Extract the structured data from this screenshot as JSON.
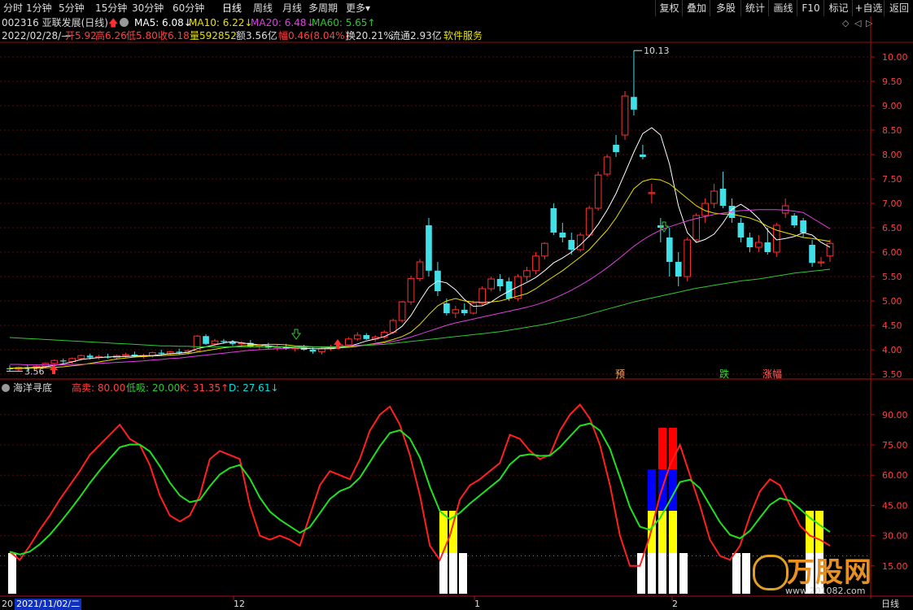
{
  "toolbar": {
    "periods": [
      "分时",
      "1分钟",
      "5分钟",
      "15分钟",
      "30分钟",
      "60分钟",
      "日线",
      "周线",
      "月线",
      "多周期",
      "更多"
    ],
    "active_period": "日线",
    "more_arrow": "▾",
    "right_buttons": [
      "复权",
      "叠加",
      "多股",
      "统计",
      "画线",
      "F10",
      "标记",
      "+自选",
      "返回"
    ]
  },
  "stock": {
    "code_name": "002316 亚联发展(日线)",
    "ma_labels": [
      {
        "text": "MA5: 6.08↓",
        "color": "#ffffff"
      },
      {
        "text": "MA10: 6.22↓",
        "color": "#e8e000"
      },
      {
        "text": "MA20: 6.48↓",
        "color": "#e040e0"
      },
      {
        "text": "MA60: 5.65↑",
        "color": "#30c830"
      }
    ],
    "date": "2022/02/28/—",
    "open": "开5.92",
    "high": "高6.26",
    "low": "低5.80",
    "close": "收6.18",
    "volume": "量592852",
    "amount": "额3.56亿",
    "change": "幅0.46(8.04%)",
    "turnover": "换20.21%",
    "float_cap": "流通2.93亿",
    "sector": "软件服务"
  },
  "price_panel": {
    "y_ticks": [
      "10.00",
      "9.50",
      "9.00",
      "8.50",
      "8.00",
      "7.50",
      "7.00",
      "6.50",
      "6.00",
      "5.50",
      "5.00",
      "4.50",
      "4.00",
      "3.50"
    ],
    "max_label": "10.13",
    "min_label": "3.56",
    "signal_labels": [
      {
        "text": "预",
        "color": "#ffb060"
      },
      {
        "text": "跌",
        "color": "#30e030"
      },
      {
        "text": "涨幅",
        "color": "#ff6060"
      }
    ]
  },
  "indicator": {
    "name": "海洋寻底",
    "params": [
      {
        "text": "高卖: 80.00",
        "color": "#ff4040"
      },
      {
        "text": "低吸: 20.00",
        "color": "#30c830"
      },
      {
        "text": "K: 31.35↑",
        "color": "#ff4040"
      },
      {
        "text": "D: 27.61↓",
        "color": "#00e0e0"
      }
    ],
    "y_ticks": [
      "90.00",
      "75.00",
      "60.00",
      "45.00",
      "30.00",
      "15.00"
    ]
  },
  "date_axis": {
    "cursor_date": "2021/11/02/二",
    "left_stub": "20",
    "months": [
      "12",
      "1",
      "2"
    ],
    "period_label": "日线"
  },
  "watermark": {
    "text": "万股网",
    "sub": "www.201082.com"
  },
  "colors": {
    "up": "#ff3030",
    "down": "#40e0e8",
    "k": "#ff2020",
    "d": "#20e020",
    "ma5": "#ffffff",
    "ma10": "#e8e000",
    "ma20": "#e040e0",
    "ma60": "#30c830"
  },
  "chart_data": {
    "type": "candlestick",
    "price_range": [
      3.4,
      10.3
    ],
    "candles": [
      [
        3.62,
        3.68,
        3.55,
        3.6
      ],
      [
        3.6,
        3.66,
        3.56,
        3.64
      ],
      [
        3.64,
        3.7,
        3.58,
        3.62
      ],
      [
        3.62,
        3.68,
        3.58,
        3.66
      ],
      [
        3.66,
        3.74,
        3.62,
        3.72
      ],
      [
        3.72,
        3.8,
        3.68,
        3.78
      ],
      [
        3.78,
        3.82,
        3.72,
        3.76
      ],
      [
        3.76,
        3.84,
        3.72,
        3.82
      ],
      [
        3.82,
        3.9,
        3.78,
        3.88
      ],
      [
        3.88,
        3.92,
        3.8,
        3.84
      ],
      [
        3.84,
        3.9,
        3.8,
        3.86
      ],
      [
        3.86,
        3.92,
        3.82,
        3.84
      ],
      [
        3.84,
        3.9,
        3.8,
        3.88
      ],
      [
        3.88,
        3.94,
        3.84,
        3.9
      ],
      [
        3.9,
        3.96,
        3.84,
        3.86
      ],
      [
        3.86,
        3.92,
        3.82,
        3.88
      ],
      [
        3.88,
        3.96,
        3.84,
        3.94
      ],
      [
        3.94,
        4.0,
        3.88,
        3.92
      ],
      [
        3.92,
        3.98,
        3.88,
        3.96
      ],
      [
        3.96,
        4.02,
        3.9,
        3.94
      ],
      [
        3.94,
        4.0,
        3.9,
        3.98
      ],
      [
        3.98,
        4.3,
        3.96,
        4.28
      ],
      [
        4.28,
        4.32,
        4.1,
        4.12
      ],
      [
        4.12,
        4.22,
        4.08,
        4.18
      ],
      [
        4.18,
        4.22,
        4.12,
        4.16
      ],
      [
        4.16,
        4.2,
        4.08,
        4.12
      ],
      [
        4.12,
        4.18,
        4.06,
        4.14
      ],
      [
        4.14,
        4.2,
        4.04,
        4.06
      ],
      [
        4.06,
        4.12,
        4.0,
        4.08
      ],
      [
        4.08,
        4.14,
        4.02,
        4.04
      ],
      [
        4.04,
        4.1,
        3.98,
        4.06
      ],
      [
        4.06,
        4.12,
        4.0,
        4.02
      ],
      [
        4.02,
        4.08,
        3.96,
        4.04
      ],
      [
        4.04,
        4.1,
        3.98,
        4.0
      ],
      [
        4.0,
        4.06,
        3.92,
        3.96
      ],
      [
        3.96,
        4.04,
        3.9,
        4.02
      ],
      [
        4.02,
        4.1,
        3.98,
        4.06
      ],
      [
        4.06,
        4.14,
        4.02,
        4.1
      ],
      [
        4.1,
        4.26,
        4.06,
        4.22
      ],
      [
        4.22,
        4.36,
        4.18,
        4.3
      ],
      [
        4.3,
        4.34,
        4.2,
        4.22
      ],
      [
        4.22,
        4.3,
        4.16,
        4.26
      ],
      [
        4.26,
        4.4,
        4.22,
        4.36
      ],
      [
        4.36,
        4.64,
        4.32,
        4.6
      ],
      [
        4.6,
        5.0,
        4.56,
        4.98
      ],
      [
        4.98,
        5.52,
        4.92,
        5.46
      ],
      [
        5.46,
        5.86,
        5.4,
        5.8
      ],
      [
        6.55,
        6.7,
        5.5,
        5.62
      ],
      [
        5.62,
        5.8,
        5.1,
        5.2
      ],
      [
        4.95,
        5.05,
        4.7,
        4.75
      ],
      [
        4.75,
        4.9,
        4.65,
        4.82
      ],
      [
        4.82,
        4.95,
        4.7,
        4.75
      ],
      [
        4.75,
        5.0,
        4.72,
        4.95
      ],
      [
        4.95,
        5.3,
        4.9,
        5.25
      ],
      [
        5.25,
        5.5,
        5.2,
        5.45
      ],
      [
        5.45,
        5.55,
        5.2,
        5.3
      ],
      [
        5.4,
        5.48,
        5.0,
        5.05
      ],
      [
        5.05,
        5.55,
        5.0,
        5.5
      ],
      [
        5.5,
        5.7,
        5.4,
        5.62
      ],
      [
        5.62,
        6.0,
        5.55,
        5.92
      ],
      [
        5.92,
        6.2,
        5.85,
        6.18
      ],
      [
        6.9,
        7.0,
        6.35,
        6.4
      ],
      [
        6.4,
        6.6,
        6.2,
        6.3
      ],
      [
        6.25,
        6.4,
        5.95,
        6.05
      ],
      [
        6.05,
        6.4,
        6.0,
        6.35
      ],
      [
        6.35,
        6.95,
        6.3,
        6.9
      ],
      [
        6.9,
        7.65,
        6.85,
        7.58
      ],
      [
        7.6,
        8.0,
        7.55,
        7.95
      ],
      [
        8.2,
        8.4,
        7.95,
        8.05
      ],
      [
        8.4,
        9.3,
        8.3,
        9.2
      ],
      [
        9.18,
        10.13,
        8.8,
        8.92
      ],
      [
        8.0,
        8.2,
        7.9,
        7.95
      ],
      [
        7.2,
        7.4,
        7.0,
        7.22
      ],
      [
        6.55,
        6.7,
        6.2,
        6.5
      ],
      [
        6.3,
        6.5,
        5.5,
        5.8
      ],
      [
        5.8,
        6.0,
        5.3,
        5.5
      ],
      [
        5.5,
        6.3,
        5.4,
        6.25
      ],
      [
        6.25,
        6.8,
        6.2,
        6.75
      ],
      [
        6.75,
        7.1,
        6.6,
        7.0
      ],
      [
        7.0,
        7.4,
        6.9,
        7.25
      ],
      [
        7.3,
        7.65,
        6.9,
        6.95
      ],
      [
        6.95,
        7.1,
        6.6,
        6.7
      ],
      [
        6.6,
        6.7,
        6.2,
        6.3
      ],
      [
        6.3,
        6.4,
        6.0,
        6.1
      ],
      [
        6.1,
        6.35,
        6.0,
        6.2
      ],
      [
        6.2,
        6.5,
        5.95,
        6.0
      ],
      [
        6.0,
        6.6,
        5.9,
        6.55
      ],
      [
        6.8,
        7.1,
        6.7,
        6.95
      ],
      [
        6.75,
        6.8,
        6.5,
        6.55
      ],
      [
        6.65,
        6.7,
        6.3,
        6.4
      ],
      [
        6.15,
        6.25,
        5.7,
        5.78
      ],
      [
        5.78,
        5.9,
        5.7,
        5.8
      ],
      [
        5.92,
        6.26,
        5.8,
        6.18
      ]
    ],
    "ma5": [
      3.62,
      3.62,
      3.63,
      3.64,
      3.65,
      3.68,
      3.71,
      3.75,
      3.8,
      3.82,
      3.84,
      3.85,
      3.86,
      3.86,
      3.87,
      3.88,
      3.88,
      3.9,
      3.92,
      3.93,
      3.95,
      4.02,
      4.06,
      4.1,
      4.14,
      4.17,
      4.14,
      4.12,
      4.1,
      4.08,
      4.06,
      4.05,
      4.04,
      4.03,
      4.02,
      4.02,
      4.02,
      4.04,
      4.07,
      4.12,
      4.18,
      4.22,
      4.27,
      4.35,
      4.48,
      4.7,
      5.0,
      5.28,
      5.41,
      5.37,
      5.23,
      5.03,
      4.89,
      4.9,
      4.98,
      5.1,
      5.2,
      5.29,
      5.38,
      5.48,
      5.62,
      5.78,
      5.88,
      6.0,
      6.15,
      6.33,
      6.57,
      6.86,
      7.2,
      7.62,
      8.05,
      8.43,
      8.55,
      8.4,
      7.8,
      6.95,
      6.4,
      6.2,
      6.26,
      6.37,
      6.6,
      6.88,
      6.98,
      6.86,
      6.69,
      6.45,
      6.25,
      6.28,
      6.32,
      6.4,
      6.35,
      6.2,
      6.1
    ],
    "ma10": [
      3.62,
      3.62,
      3.62,
      3.63,
      3.63,
      3.64,
      3.65,
      3.67,
      3.69,
      3.72,
      3.75,
      3.78,
      3.81,
      3.83,
      3.85,
      3.86,
      3.87,
      3.88,
      3.89,
      3.9,
      3.92,
      3.95,
      3.98,
      4.01,
      4.04,
      4.06,
      4.08,
      4.09,
      4.1,
      4.11,
      4.11,
      4.1,
      4.08,
      4.07,
      4.06,
      4.05,
      4.04,
      4.04,
      4.05,
      4.07,
      4.1,
      4.13,
      4.16,
      4.21,
      4.27,
      4.36,
      4.52,
      4.72,
      4.9,
      5.0,
      5.05,
      5.0,
      4.98,
      4.97,
      4.98,
      5.0,
      5.05,
      5.1,
      5.15,
      5.25,
      5.38,
      5.5,
      5.62,
      5.76,
      5.9,
      6.05,
      6.25,
      6.45,
      6.7,
      7.0,
      7.3,
      7.45,
      7.5,
      7.48,
      7.4,
      7.25,
      7.1,
      6.95,
      6.85,
      6.8,
      6.78,
      6.78,
      6.74,
      6.7,
      6.63,
      6.53,
      6.45,
      6.4,
      6.35,
      6.3,
      6.28,
      6.25,
      6.22
    ],
    "ma20": [
      3.7,
      3.7,
      3.69,
      3.69,
      3.69,
      3.69,
      3.69,
      3.7,
      3.7,
      3.71,
      3.72,
      3.73,
      3.74,
      3.75,
      3.76,
      3.77,
      3.79,
      3.8,
      3.82,
      3.83,
      3.85,
      3.87,
      3.89,
      3.91,
      3.93,
      3.95,
      3.97,
      3.99,
      4.0,
      4.01,
      4.02,
      4.03,
      4.04,
      4.05,
      4.05,
      4.06,
      4.06,
      4.07,
      4.08,
      4.09,
      4.1,
      4.12,
      4.14,
      4.17,
      4.21,
      4.26,
      4.32,
      4.38,
      4.44,
      4.5,
      4.55,
      4.59,
      4.63,
      4.67,
      4.71,
      4.75,
      4.79,
      4.83,
      4.87,
      4.92,
      4.98,
      5.05,
      5.13,
      5.22,
      5.32,
      5.43,
      5.55,
      5.68,
      5.82,
      5.97,
      6.12,
      6.25,
      6.36,
      6.45,
      6.52,
      6.58,
      6.64,
      6.69,
      6.73,
      6.77,
      6.8,
      6.83,
      6.85,
      6.86,
      6.87,
      6.87,
      6.87,
      6.86,
      6.84,
      6.81,
      6.7,
      6.59,
      6.48
    ],
    "ma60": [
      4.25,
      4.24,
      4.23,
      4.22,
      4.21,
      4.2,
      4.19,
      4.18,
      4.17,
      4.16,
      4.15,
      4.14,
      4.13,
      4.12,
      4.11,
      4.1,
      4.09,
      4.08,
      4.08,
      4.07,
      4.07,
      4.06,
      4.06,
      4.06,
      4.06,
      4.06,
      4.06,
      4.06,
      4.06,
      4.06,
      4.06,
      4.06,
      4.06,
      4.06,
      4.06,
      4.06,
      4.06,
      4.06,
      4.07,
      4.08,
      4.09,
      4.1,
      4.11,
      4.13,
      4.15,
      4.17,
      4.19,
      4.21,
      4.23,
      4.25,
      4.27,
      4.29,
      4.31,
      4.33,
      4.35,
      4.37,
      4.4,
      4.43,
      4.46,
      4.49,
      4.52,
      4.56,
      4.6,
      4.64,
      4.68,
      4.73,
      4.78,
      4.83,
      4.88,
      4.93,
      4.98,
      5.02,
      5.06,
      5.1,
      5.14,
      5.18,
      5.22,
      5.26,
      5.29,
      5.32,
      5.35,
      5.38,
      5.41,
      5.43,
      5.45,
      5.48,
      5.51,
      5.54,
      5.57,
      5.59,
      5.61,
      5.63,
      5.65
    ],
    "indicator_range": [
      0,
      100
    ],
    "K": [
      22,
      18,
      25,
      33,
      40,
      48,
      55,
      62,
      70,
      75,
      80,
      85,
      78,
      75,
      65,
      50,
      40,
      37,
      40,
      50,
      68,
      72,
      70,
      68,
      45,
      30,
      28,
      30,
      28,
      25,
      40,
      55,
      62,
      60,
      58,
      68,
      82,
      90,
      94,
      85,
      70,
      50,
      25,
      18,
      30,
      48,
      55,
      58,
      62,
      66,
      80,
      78,
      72,
      68,
      70,
      82,
      90,
      95,
      88,
      75,
      55,
      30,
      15,
      15,
      30,
      50,
      65,
      75,
      60,
      45,
      28,
      20,
      18,
      25,
      40,
      52,
      58,
      55,
      45,
      35,
      30,
      28,
      25
    ]
  }
}
